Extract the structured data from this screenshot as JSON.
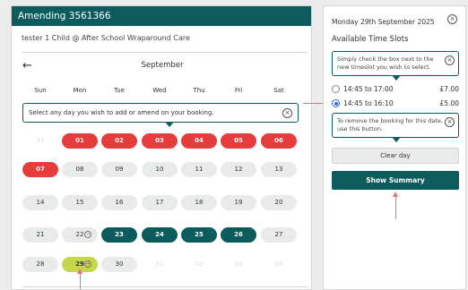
{
  "header": {
    "title": "Amending 3561366"
  },
  "child": {
    "line": "tester 1 Child @ After School Wraparound Care"
  },
  "calendar": {
    "month": "September",
    "weekdays": [
      "Sun",
      "Mon",
      "Tue",
      "Wed",
      "Thu",
      "Fri",
      "Sat"
    ],
    "tooltip": "Select any day you wish to add or amend on your booking.",
    "rows": [
      [
        {
          "d": "31",
          "s": "faded"
        },
        {
          "d": "01",
          "s": "booked"
        },
        {
          "d": "02",
          "s": "booked"
        },
        {
          "d": "03",
          "s": "booked"
        },
        {
          "d": "04",
          "s": "booked"
        },
        {
          "d": "05",
          "s": "booked"
        },
        {
          "d": "06",
          "s": "booked"
        }
      ],
      [
        {
          "d": "07",
          "s": "booked"
        },
        {
          "d": "08",
          "s": "empty"
        },
        {
          "d": "09",
          "s": "empty"
        },
        {
          "d": "10",
          "s": "empty"
        },
        {
          "d": "11",
          "s": "empty"
        },
        {
          "d": "12",
          "s": "empty"
        },
        {
          "d": "13",
          "s": "empty"
        }
      ],
      [
        {
          "d": "14",
          "s": "empty"
        },
        {
          "d": "15",
          "s": "empty"
        },
        {
          "d": "16",
          "s": "empty"
        },
        {
          "d": "17",
          "s": "empty"
        },
        {
          "d": "18",
          "s": "empty"
        },
        {
          "d": "19",
          "s": "empty"
        },
        {
          "d": "20",
          "s": "empty"
        }
      ],
      [
        {
          "d": "21",
          "s": "empty"
        },
        {
          "d": "22",
          "s": "empty",
          "icon": true
        },
        {
          "d": "23",
          "s": "amended"
        },
        {
          "d": "24",
          "s": "amended"
        },
        {
          "d": "25",
          "s": "amended"
        },
        {
          "d": "26",
          "s": "amended"
        },
        {
          "d": "27",
          "s": "empty"
        }
      ],
      [
        {
          "d": "28",
          "s": "empty"
        },
        {
          "d": "29",
          "s": "selected",
          "icon": true
        },
        {
          "d": "30",
          "s": "empty"
        },
        {
          "d": "01",
          "s": "faded"
        },
        {
          "d": "02",
          "s": "faded"
        },
        {
          "d": "03",
          "s": "faded"
        },
        {
          "d": "04",
          "s": "faded"
        }
      ]
    ]
  },
  "side": {
    "date": "Monday 29th September 2025",
    "title": "Available Time Slots",
    "tip1": "Simply check the box next to the new timeslot you wish to select.",
    "slots": [
      {
        "time": "14:45 to 17:00",
        "price": "£7.00",
        "checked": false
      },
      {
        "time": "14:45 to 16:10",
        "price": "£5.00",
        "checked": true
      }
    ],
    "tip2": "To remove the booking for this date, use this button.",
    "clear_label": "Clear day",
    "summary_label": "Show Summary"
  },
  "colors": {
    "brand": "#0c5b5d",
    "booked": "#e63c3c",
    "selected": "#c4d64a",
    "arrow": "#e7707a"
  }
}
